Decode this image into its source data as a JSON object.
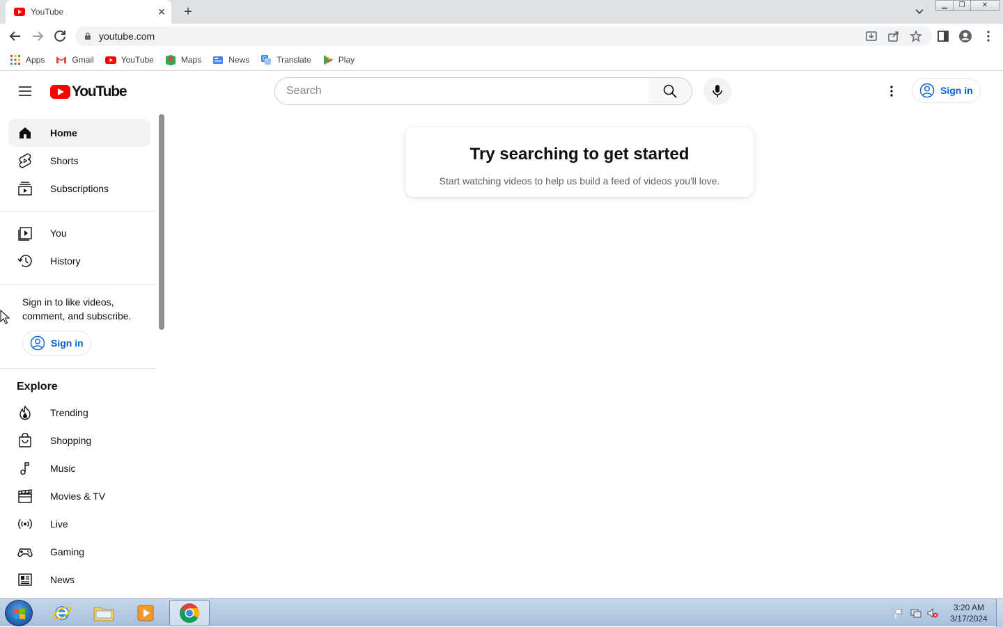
{
  "browser": {
    "tab_title": "YouTube",
    "url": "youtube.com",
    "bookmarks": [
      {
        "label": "Apps",
        "icon": "apps-grid-icon"
      },
      {
        "label": "Gmail",
        "icon": "gmail-icon"
      },
      {
        "label": "YouTube",
        "icon": "youtube-icon"
      },
      {
        "label": "Maps",
        "icon": "maps-icon"
      },
      {
        "label": "News",
        "icon": "news-icon"
      },
      {
        "label": "Translate",
        "icon": "translate-icon"
      },
      {
        "label": "Play",
        "icon": "play-store-icon"
      }
    ]
  },
  "masthead": {
    "logo_text": "YouTube",
    "search_placeholder": "Search",
    "sign_in_label": "Sign in"
  },
  "sidebar": {
    "primary": [
      {
        "label": "Home",
        "icon": "home-icon",
        "active": true
      },
      {
        "label": "Shorts",
        "icon": "shorts-icon"
      },
      {
        "label": "Subscriptions",
        "icon": "subscriptions-icon"
      }
    ],
    "library": [
      {
        "label": "You",
        "icon": "you-icon"
      },
      {
        "label": "History",
        "icon": "history-icon"
      }
    ],
    "sign_in_prompt": "Sign in to like videos, comment, and subscribe.",
    "sign_in_label": "Sign in",
    "explore_title": "Explore",
    "explore": [
      {
        "label": "Trending",
        "icon": "trending-icon"
      },
      {
        "label": "Shopping",
        "icon": "shopping-icon"
      },
      {
        "label": "Music",
        "icon": "music-icon"
      },
      {
        "label": "Movies & TV",
        "icon": "movies-icon"
      },
      {
        "label": "Live",
        "icon": "live-icon"
      },
      {
        "label": "Gaming",
        "icon": "gaming-icon"
      },
      {
        "label": "News",
        "icon": "news-icon"
      }
    ]
  },
  "main": {
    "card_title": "Try searching to get started",
    "card_subtitle": "Start watching videos to help us build a feed of videos you'll love."
  },
  "taskbar": {
    "time": "3:20 AM",
    "date": "3/17/2024"
  },
  "colors": {
    "brand_red": "#ff0000",
    "link_blue": "#065fd4",
    "active_bg": "#f2f2f2"
  }
}
